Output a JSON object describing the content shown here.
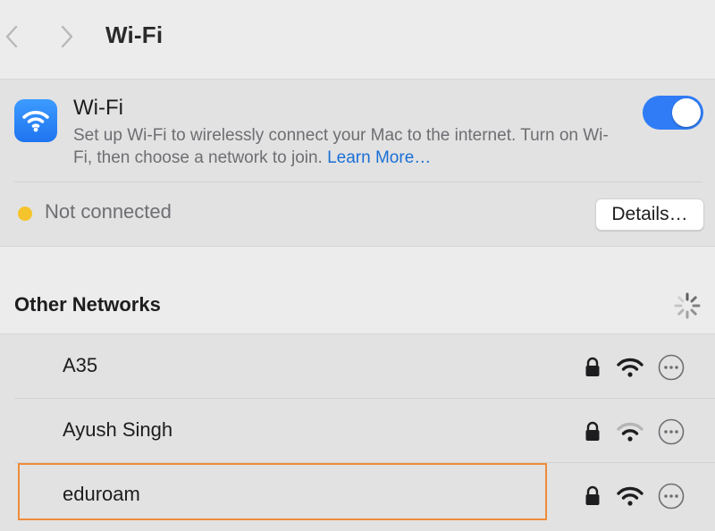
{
  "toolbar": {
    "title": "Wi-Fi",
    "back_icon": "chevron-left-icon",
    "forward_icon": "chevron-right-icon"
  },
  "wifi_card": {
    "title": "Wi-Fi",
    "description": "Set up Wi-Fi to wirelessly connect your Mac to the internet. Turn on Wi-Fi, then choose a network to join.",
    "learn_more": "Learn More…",
    "toggle_on": true,
    "status": "Not connected",
    "status_color": "#f5c42c",
    "details_label": "Details…"
  },
  "other_networks": {
    "title": "Other Networks",
    "networks": [
      {
        "name": "A35",
        "secured": true,
        "signal": "strong"
      },
      {
        "name": "Ayush Singh",
        "secured": true,
        "signal": "weak"
      },
      {
        "name": "eduroam",
        "secured": true,
        "signal": "strong"
      }
    ]
  },
  "colors": {
    "accent": "#2f7cf6",
    "highlight_outline": "#ef8b3a"
  }
}
